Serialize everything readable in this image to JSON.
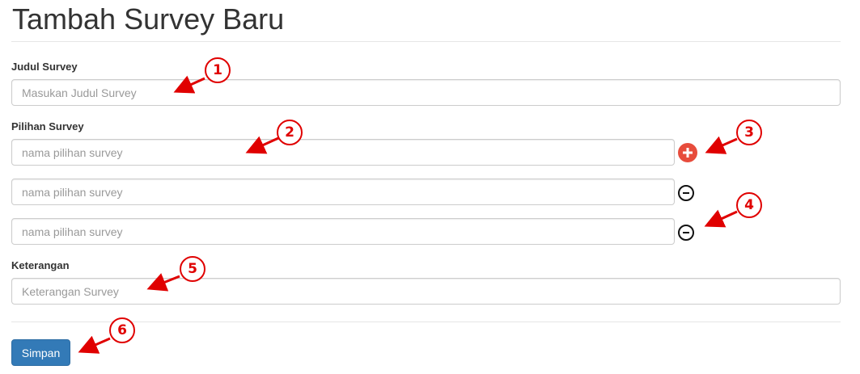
{
  "page": {
    "title": "Tambah Survey Baru"
  },
  "form": {
    "title_field": {
      "label": "Judul Survey",
      "placeholder": "Masukan Judul Survey",
      "value": ""
    },
    "options_field": {
      "label": "Pilihan Survey",
      "items": [
        {
          "placeholder": "nama pilihan survey",
          "value": "",
          "action": "add-icon"
        },
        {
          "placeholder": "nama pilihan survey",
          "value": "",
          "action": "remove-icon"
        },
        {
          "placeholder": "nama pilihan survey",
          "value": "",
          "action": "remove-icon"
        }
      ]
    },
    "description_field": {
      "label": "Keterangan",
      "placeholder": "Keterangan Survey",
      "value": ""
    },
    "save_label": "Simpan"
  },
  "annotations": {
    "callouts": [
      "1",
      "2",
      "3",
      "4",
      "5",
      "6"
    ]
  },
  "colors": {
    "primary": "#337ab7",
    "add_button": "#e74c3c",
    "annotation": "#e00000"
  }
}
